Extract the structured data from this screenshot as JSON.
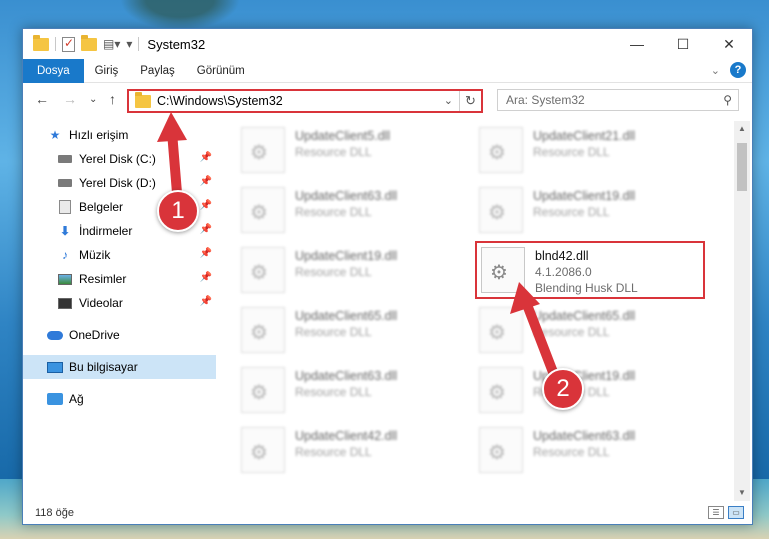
{
  "window": {
    "title": "System32"
  },
  "titlebar": {
    "minimize_icon": "minimize-icon",
    "maximize_icon": "maximize-icon",
    "close_icon": "close-icon",
    "minimize_glyph": "—",
    "maximize_glyph": "☐",
    "close_glyph": "✕"
  },
  "ribbon": {
    "tabs": [
      {
        "label": "Dosya",
        "active": true
      },
      {
        "label": "Giriş"
      },
      {
        "label": "Paylaş"
      },
      {
        "label": "Görünüm"
      }
    ],
    "help": "?"
  },
  "address": {
    "path": "C:\\Windows\\System32",
    "search_placeholder": "Ara: System32"
  },
  "nav": {
    "items": [
      {
        "label": "Hızlı erişim",
        "icon": "star-icon"
      },
      {
        "label": "Yerel Disk (C:)",
        "icon": "disk-icon",
        "pinned": true
      },
      {
        "label": "Yerel Disk (D:)",
        "icon": "disk-icon",
        "pinned": true
      },
      {
        "label": "Belgeler",
        "icon": "documents-icon",
        "pinned": true
      },
      {
        "label": "İndirmeler",
        "icon": "downloads-icon",
        "pinned": true
      },
      {
        "label": "Müzik",
        "icon": "music-icon",
        "pinned": true
      },
      {
        "label": "Resimler",
        "icon": "pictures-icon",
        "pinned": true
      },
      {
        "label": "Videolar",
        "icon": "videos-icon",
        "pinned": true
      },
      {
        "label": "OneDrive",
        "icon": "onedrive-icon"
      },
      {
        "label": "Bu bilgisayar",
        "icon": "this-pc-icon",
        "selected": true
      },
      {
        "label": "Ağ",
        "icon": "network-icon"
      }
    ]
  },
  "files": {
    "left": [
      {
        "name": "UpdateClient5.dll",
        "desc": "Resource DLL"
      },
      {
        "name": "UpdateClient63.dll",
        "desc": "Resource DLL"
      },
      {
        "name": "UpdateClient19.dll",
        "desc": "Resource DLL"
      },
      {
        "name": "UpdateClient65.dll",
        "desc": "Resource DLL"
      },
      {
        "name": "UpdateClient63.dll",
        "desc": "Resource DLL"
      },
      {
        "name": "UpdateClient42.dll",
        "desc": "Resource DLL"
      }
    ],
    "right": [
      {
        "name": "UpdateClient21.dll",
        "desc": "Resource DLL"
      },
      {
        "name": "UpdateClient19.dll",
        "desc": "Resource DLL"
      },
      {
        "name": "blnd42.dll",
        "version": "4.1.2086.0",
        "desc": "Blending Husk DLL",
        "highlight": true
      },
      {
        "name": "UpdateClient65.dll",
        "desc": "Resource DLL"
      },
      {
        "name": "UpdateClient19.dll",
        "desc": "Resource DLL"
      },
      {
        "name": "UpdateClient63.dll",
        "desc": "Resource DLL"
      }
    ]
  },
  "status": {
    "count": "118 öğe"
  },
  "annotations": {
    "badge1": "1",
    "badge2": "2"
  },
  "colors": {
    "accent": "#1979ca",
    "annotation_red": "#d9343a",
    "selection": "#cce4f7"
  }
}
